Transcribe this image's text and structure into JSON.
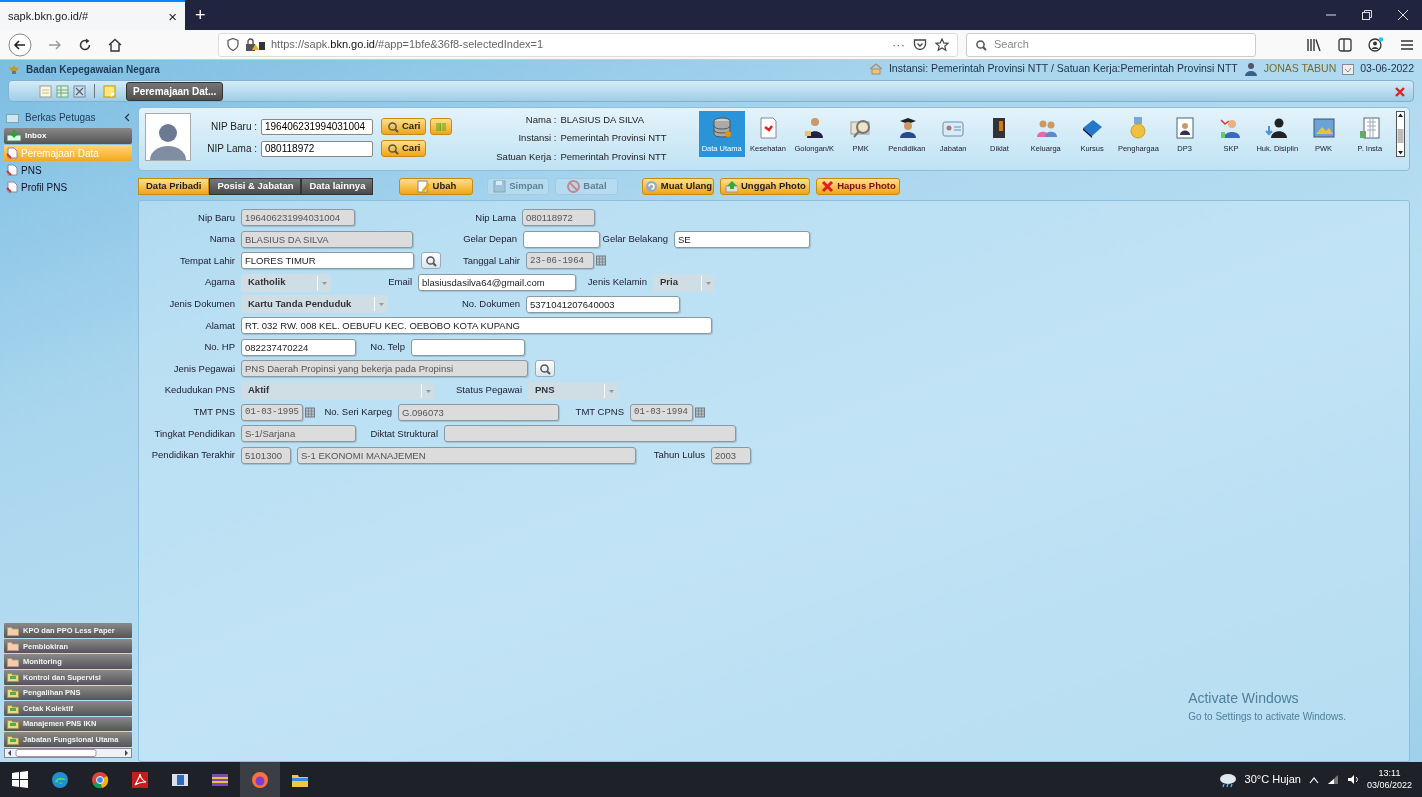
{
  "browser": {
    "tab_title": "sapk.bkn.go.id/#",
    "tab_close": "×",
    "new_tab": "+",
    "url": "https://sapk.**bkn.go.id**/#app=1bfe&36f8-selectedIndex=1",
    "more": "···",
    "search_placeholder": "Search"
  },
  "app_header": {
    "title": "Badan Kepegawaian Negara",
    "unit": "Instansi: Pemerintah Provinsi NTT / Satuan Kerja:Pemerintah Provinsi NTT",
    "user": "JONAS TABUN",
    "date": "03-06-2022"
  },
  "toolbar": {
    "open_tabs": [
      {
        "label": "Peremajaan Dat...",
        "selected": true
      }
    ]
  },
  "sidebar": {
    "title": "Berkas Petugas",
    "items": [
      {
        "label": "Inbox",
        "kind": "group",
        "selected": false
      },
      {
        "label": "Peremajaan Data",
        "kind": "item",
        "selected": true
      },
      {
        "label": "PNS",
        "kind": "item",
        "selected": false
      },
      {
        "label": "Profil PNS",
        "kind": "item",
        "selected": false
      }
    ],
    "sections": [
      {
        "label": "KPO dan PPO Less Paper",
        "kind": "folder"
      },
      {
        "label": "Pemblokiran",
        "kind": "folder"
      },
      {
        "label": "Monitoring",
        "kind": "folder"
      },
      {
        "label": "Kontrol dan Supervisi",
        "kind": "tray"
      },
      {
        "label": "Pengalihan PNS",
        "kind": "tray"
      },
      {
        "label": "Cetak Kolektif",
        "kind": "tray"
      },
      {
        "label": "Manajemen PNS IKN",
        "kind": "tray"
      },
      {
        "label": "Jabatan Fungsional Utama",
        "kind": "tray"
      }
    ]
  },
  "search": {
    "fields": [
      {
        "label": "NIP Baru :",
        "value": "196406231994031004",
        "button": "Cari"
      },
      {
        "label": "NIP Lama :",
        "value": "080118972",
        "button": "Cari"
      }
    ],
    "info": [
      {
        "label": "Nama :",
        "value": "BLASIUS DA SILVA"
      },
      {
        "label": "Instansi :",
        "value": "Pemerintah Provinsi NTT"
      },
      {
        "label": "Satuan Kerja :",
        "value": "Pemerintah Provinsi NTT"
      }
    ]
  },
  "modules": [
    {
      "label": "Data Utama",
      "kind": "database",
      "selected": true
    },
    {
      "label": "Kesehatan",
      "kind": "document",
      "selected": false
    },
    {
      "label": "Golongan/K",
      "kind": "officer",
      "selected": false
    },
    {
      "label": "PMK",
      "kind": "magnifier",
      "selected": false
    },
    {
      "label": "Pendidikan",
      "kind": "graduate",
      "selected": false
    },
    {
      "label": "Jabatan",
      "kind": "idcard",
      "selected": false
    },
    {
      "label": "Diklat",
      "kind": "door",
      "selected": false
    },
    {
      "label": "Keluarga",
      "kind": "family",
      "selected": false
    },
    {
      "label": "Kursus",
      "kind": "book",
      "selected": false
    },
    {
      "label": "Penghargaa",
      "kind": "medal",
      "selected": false
    },
    {
      "label": "DP3",
      "kind": "portrait",
      "selected": false
    },
    {
      "label": "SKP",
      "kind": "award",
      "selected": false
    },
    {
      "label": "Huk. Disiplin",
      "kind": "person",
      "selected": false
    },
    {
      "label": "PWK",
      "kind": "picture",
      "selected": false
    },
    {
      "label": "P. Insta",
      "kind": "building",
      "selected": false
    }
  ],
  "tabs": [
    {
      "label": "Data Pribadi",
      "selected": true
    },
    {
      "label": "Posisi & Jabatan",
      "selected": false
    },
    {
      "label": "Data lainnya",
      "selected": false
    }
  ],
  "actions": [
    {
      "label": "Ubah",
      "kind": "edit",
      "disabled": false
    },
    {
      "label": "Simpan",
      "kind": "save",
      "disabled": true
    },
    {
      "label": "Batal",
      "kind": "cancel",
      "disabled": true
    },
    {
      "label": "Muat Ulang",
      "kind": "reload",
      "disabled": false
    },
    {
      "label": "Unggah Photo",
      "kind": "upload",
      "disabled": false
    },
    {
      "label": "Hapus Photo",
      "kind": "delete",
      "disabled": false
    }
  ],
  "form": {
    "rows": [
      [
        {
          "label": "Nip Baru",
          "value": "196406231994031004",
          "kind": "text",
          "disabled": true
        },
        {
          "label": "Nip Lama",
          "value": "080118972",
          "kind": "text",
          "disabled": true
        }
      ],
      [
        {
          "label": "Nama",
          "value": "BLASIUS DA SILVA",
          "kind": "text",
          "disabled": true
        },
        {
          "label": "Gelar Depan",
          "kind": "text",
          "disabled": false
        },
        {
          "label": "Gelar Belakang",
          "value": "SE",
          "kind": "text",
          "disabled": false
        }
      ],
      [
        {
          "label": "Tempat Lahir",
          "value": "FLORES TIMUR",
          "kind": "text",
          "disabled": false,
          "lookup": true
        },
        {
          "label": "Tanggal Lahir",
          "value": "23-06-1964",
          "kind": "date",
          "disabled": true
        }
      ],
      [
        {
          "label": "Agama",
          "value": "Katholik",
          "kind": "select",
          "disabled": true
        },
        {
          "label": "Email",
          "value": "blasiusdasilva64@gmail.com",
          "kind": "text",
          "disabled": false
        },
        {
          "label": "Jenis Kelamin",
          "value": "Pria",
          "kind": "select",
          "disabled": true
        }
      ],
      [
        {
          "label": "Jenis Dokumen",
          "value": "Kartu Tanda Penduduk",
          "kind": "select",
          "disabled": true
        },
        {
          "label": "No. Dokumen",
          "value": "5371041207640003",
          "kind": "text",
          "disabled": false
        }
      ],
      [
        {
          "label": "Alamat",
          "value": "RT. 032 RW. 008 KEL. OEBUFU KEC. OEBOBO KOTA KUPANG",
          "kind": "text",
          "disabled": false
        }
      ],
      [
        {
          "label": "No. HP",
          "value": "082237470224",
          "kind": "text",
          "disabled": false
        },
        {
          "label": "No. Telp",
          "kind": "text",
          "disabled": false
        }
      ],
      [
        {
          "label": "Jenis Pegawai",
          "value": "PNS Daerah Propinsi yang bekerja pada Propinsi",
          "kind": "text",
          "disabled": true,
          "lookup": true
        }
      ],
      [
        {
          "label": "Kedudukan PNS",
          "value": "Aktif",
          "kind": "select",
          "disabled": true
        },
        {
          "label": "Status Pegawai",
          "value": "PNS",
          "kind": "select",
          "disabled": true
        }
      ],
      [
        {
          "label": "TMT PNS",
          "value": "01-03-1995",
          "kind": "date",
          "disabled": true
        },
        {
          "label": "No. Seri Karpeg",
          "value": "G.096073",
          "kind": "text",
          "disabled": true
        },
        {
          "label": "TMT CPNS",
          "value": "01-03-1994",
          "kind": "date",
          "disabled": true
        }
      ],
      [
        {
          "label": "Tingkat Pendidikan",
          "value": "S-1/Sarjana",
          "kind": "text",
          "disabled": true
        },
        {
          "label": "Diktat Struktural",
          "kind": "text",
          "disabled": true
        }
      ],
      [
        {
          "label": "Pendidikan Terakhir",
          "value": "5101300",
          "kind": "text",
          "disabled": true
        },
        {
          "value": "S-1 EKONOMI MANAJEMEN",
          "kind": "text",
          "disabled": true
        },
        {
          "label": "Tahun Lulus",
          "value": "2003",
          "kind": "text",
          "disabled": true
        }
      ]
    ]
  },
  "os_notice": {
    "title": "Activate Windows",
    "subtitle": "Go to Settings to activate Windows."
  },
  "taskbar": {
    "apps": [
      {
        "kind": "start",
        "selected": false
      },
      {
        "kind": "edge",
        "selected": false
      },
      {
        "kind": "chrome",
        "selected": false
      },
      {
        "kind": "acrobat",
        "selected": false
      },
      {
        "kind": "app",
        "selected": false
      },
      {
        "kind": "archive",
        "selected": false
      },
      {
        "kind": "firefox",
        "selected": true
      },
      {
        "kind": "explorer",
        "selected": false
      }
    ],
    "weather": "30°C Hujan",
    "time": "13:11",
    "date": "03/06/2022"
  }
}
